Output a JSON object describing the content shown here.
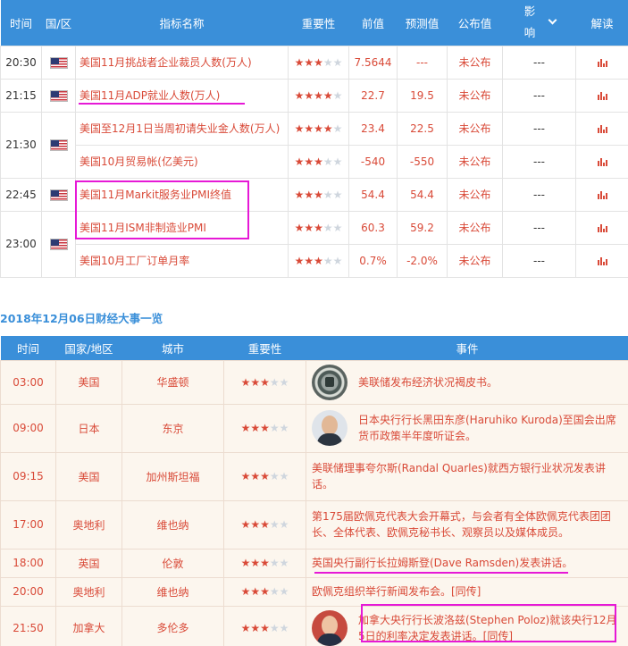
{
  "indicators": {
    "columns": [
      "时间",
      "国/区",
      "指标名称",
      "重要性",
      "前值",
      "预测值",
      "公布值",
      "影响",
      "解读"
    ],
    "groups": [
      {
        "time": "20:30",
        "rows": [
          {
            "name": "美国11月挑战者企业裁员人数(万人)",
            "stars": 3,
            "prev": "7.5644",
            "forecast": "---",
            "actual": "未公布",
            "impact": "---"
          }
        ]
      },
      {
        "time": "21:15",
        "rows": [
          {
            "name": "美国11月ADP就业人数(万人)",
            "stars": 4,
            "prev": "22.7",
            "forecast": "19.5",
            "actual": "未公布",
            "impact": "---"
          }
        ]
      },
      {
        "time": "21:30",
        "rows": [
          {
            "name": "美国至12月1日当周初请失业金人数(万人)",
            "stars": 4,
            "prev": "23.4",
            "forecast": "22.5",
            "actual": "未公布",
            "impact": "---"
          },
          {
            "name": "美国10月贸易帐(亿美元)",
            "stars": 3,
            "prev": "-540",
            "forecast": "-550",
            "actual": "未公布",
            "impact": "---"
          }
        ]
      },
      {
        "time": "22:45",
        "rows": [
          {
            "name": "美国11月Markit服务业PMI终值",
            "stars": 3,
            "prev": "54.4",
            "forecast": "54.4",
            "actual": "未公布",
            "impact": "---"
          }
        ]
      },
      {
        "time": "23:00",
        "rows": [
          {
            "name": "美国11月ISM非制造业PMI",
            "stars": 3,
            "prev": "60.3",
            "forecast": "59.2",
            "actual": "未公布",
            "impact": "---"
          },
          {
            "name": "美国10月工厂订单月率",
            "stars": 3,
            "prev": "0.7%",
            "forecast": "-2.0%",
            "actual": "未公布",
            "impact": "---"
          }
        ]
      }
    ]
  },
  "events": {
    "title": "2018年12月06日财经大事一览",
    "columns": [
      "时间",
      "国家/地区",
      "城市",
      "重要性",
      "事件"
    ],
    "rows": [
      {
        "time": "03:00",
        "country": "美国",
        "city": "华盛顿",
        "stars": 3,
        "avatar": "fed-seal",
        "text": "美联储发布经济状况褐皮书。"
      },
      {
        "time": "09:00",
        "country": "日本",
        "city": "东京",
        "stars": 3,
        "avatar": "kuroda-portrait",
        "text": "日本央行行长黑田东彦(Haruhiko Kuroda)至国会出席货币政策半年度听证会。"
      },
      {
        "time": "09:15",
        "country": "美国",
        "city": "加州斯坦福",
        "stars": 3,
        "avatar": "",
        "text": "美联储理事夸尔斯(Randal Quarles)就西方银行业状况发表讲话。"
      },
      {
        "time": "17:00",
        "country": "奥地利",
        "city": "维也纳",
        "stars": 3,
        "avatar": "",
        "text": "第175届欧佩克代表大会开幕式，与会者有全体欧佩克代表团团长、全体代表、欧佩克秘书长、观察员以及媒体成员。"
      },
      {
        "time": "18:00",
        "country": "英国",
        "city": "伦敦",
        "stars": 3,
        "avatar": "",
        "text": "英国央行副行长拉姆斯登(Dave Ramsden)发表讲话。"
      },
      {
        "time": "20:00",
        "country": "奥地利",
        "city": "维也纳",
        "stars": 3,
        "avatar": "",
        "text": "欧佩克组织举行新闻发布会。[同传]"
      },
      {
        "time": "21:50",
        "country": "加拿大",
        "city": "多伦多",
        "stars": 3,
        "avatar": "poloz-portrait",
        "text": "加拿大央行行长波洛兹(Stephen Poloz)就该央行12月5日的利率决定发表讲话。[同传]"
      }
    ]
  },
  "colors": {
    "header_blue": "#3a8fd9",
    "text_red": "#d94a38",
    "annotation_magenta": "#e619d6",
    "star_off": "#cfd6de",
    "row_shade": "#fcf6ee"
  },
  "icons": {
    "flag": "us-flag-icon",
    "chart": "bar-chart-icon",
    "impact_toggle": "chevron-down-icon"
  }
}
